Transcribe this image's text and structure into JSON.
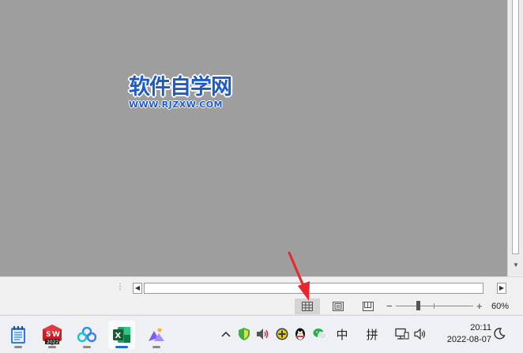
{
  "watermark": {
    "title": "软件自学网",
    "url": "WWW.RJZXW.COM"
  },
  "statusbar": {
    "zoom_level": "60%",
    "zoom_minus": "−",
    "zoom_plus": "+"
  },
  "taskbar": {
    "apps": [
      {
        "name": "Notepad",
        "icon": "notepad-icon"
      },
      {
        "name": "SOLIDWORKS 2022",
        "icon": "solidworks-icon",
        "badge": "2022"
      },
      {
        "name": "Baidu Netdisk",
        "icon": "cloud-icon"
      },
      {
        "name": "Excel",
        "icon": "excel-icon",
        "active": true
      },
      {
        "name": "Creative app",
        "icon": "creative-app-icon"
      }
    ],
    "tray": {
      "ime_lang": "中",
      "ime_mode": "拼",
      "time": "20:11",
      "date": "2022-08-07"
    }
  },
  "colors": {
    "canvas": "#9e9e9e",
    "watermark_blue": "#1d5cc8",
    "annotation_red": "#e8262b",
    "excel_green": "#1d6f42",
    "active_indicator": "#1a6dd0"
  }
}
